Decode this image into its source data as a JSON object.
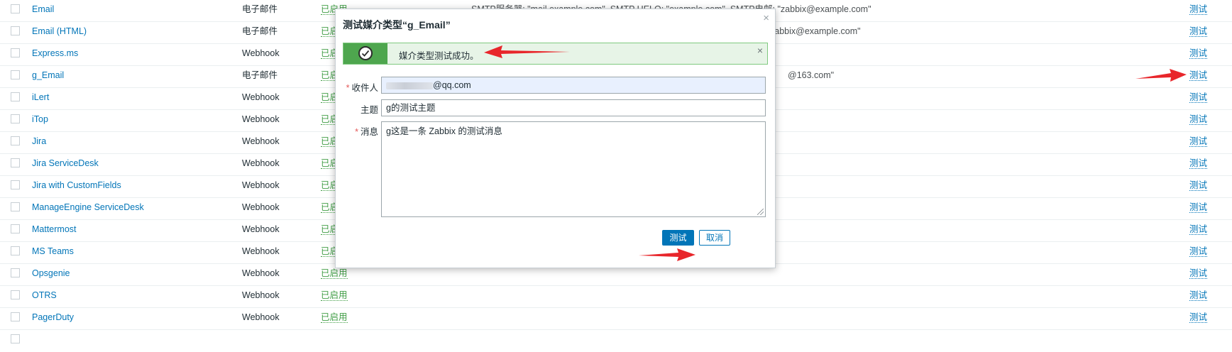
{
  "table": {
    "rows": [
      {
        "name": "Email",
        "type": "电子邮件",
        "status": "已启用",
        "details": "SMTP服务器: \"mail.example.com\", SMTP HELO: \"example.com\", SMTP电邮: \"zabbix@example.com\"",
        "action": "测试"
      },
      {
        "name": "Email (HTML)",
        "type": "电子邮件",
        "status": "已启用",
        "details": "zabbix@example.com\"",
        "action": "测试"
      },
      {
        "name": "Express.ms",
        "type": "Webhook",
        "status": "已启用",
        "details": "",
        "action": "测试"
      },
      {
        "name": "g_Email",
        "type": "电子邮件",
        "status": "已启用",
        "details": "@163.com\"",
        "action": "测试"
      },
      {
        "name": "iLert",
        "type": "Webhook",
        "status": "已启用",
        "details": "",
        "action": "测试"
      },
      {
        "name": "iTop",
        "type": "Webhook",
        "status": "已启用",
        "details": "",
        "action": "测试"
      },
      {
        "name": "Jira",
        "type": "Webhook",
        "status": "已启用",
        "details": "",
        "action": "测试"
      },
      {
        "name": "Jira ServiceDesk",
        "type": "Webhook",
        "status": "已启用",
        "details": "",
        "action": "测试"
      },
      {
        "name": "Jira with CustomFields",
        "type": "Webhook",
        "status": "已启用",
        "details": "",
        "action": "测试"
      },
      {
        "name": "ManageEngine ServiceDesk",
        "type": "Webhook",
        "status": "已启用",
        "details": "",
        "action": "测试"
      },
      {
        "name": "Mattermost",
        "type": "Webhook",
        "status": "已启用",
        "details": "",
        "action": "测试"
      },
      {
        "name": "MS Teams",
        "type": "Webhook",
        "status": "已启用",
        "details": "",
        "action": "测试"
      },
      {
        "name": "Opsgenie",
        "type": "Webhook",
        "status": "已启用",
        "details": "",
        "action": "测试"
      },
      {
        "name": "OTRS",
        "type": "Webhook",
        "status": "已启用",
        "details": "",
        "action": "测试"
      },
      {
        "name": "PagerDuty",
        "type": "Webhook",
        "status": "已启用",
        "details": "",
        "action": "测试"
      }
    ]
  },
  "modal": {
    "title": "测试媒介类型“g_Email”",
    "close": "×",
    "success_message": "媒介类型测试成功。",
    "success_close": "×",
    "recipient_label": "收件人",
    "recipient_value": "@qq.com",
    "subject_label": "主题",
    "subject_value": "g的测试主题",
    "message_label": "消息",
    "message_value": "g这是一条 Zabbix 的测试消息",
    "test_button": "测试",
    "cancel_button": "取消"
  },
  "colors": {
    "link": "#0275b8",
    "enabled": "#429e47",
    "success_bg": "#e7f4e7",
    "success_icon_bg": "#4ea64e",
    "annotation_arrow": "#e8262b"
  },
  "icons": [
    "checkmark-circle-icon",
    "close-icon",
    "annotation-arrow-icon"
  ]
}
